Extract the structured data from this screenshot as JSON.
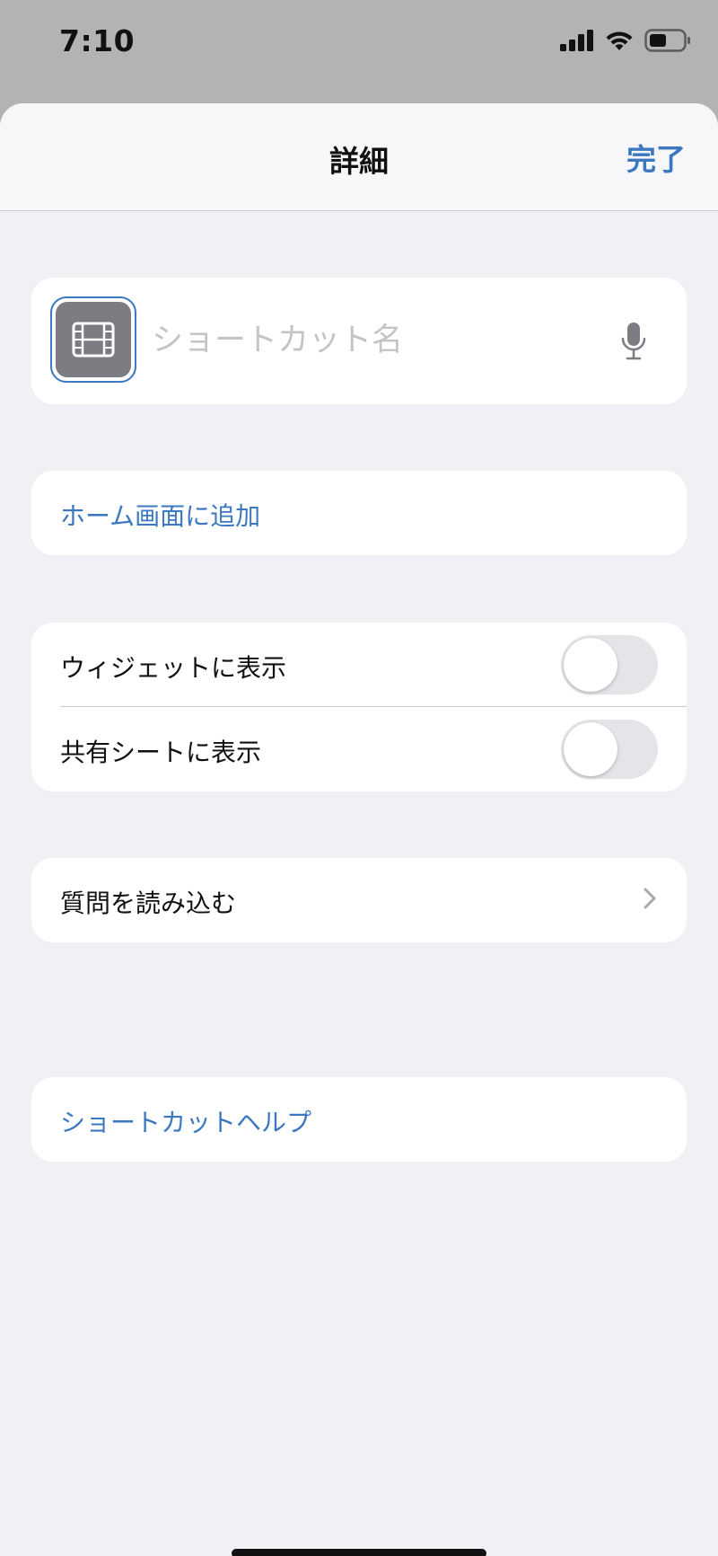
{
  "status_bar": {
    "time": "7:10",
    "icons": [
      "cellular-signal-icon",
      "wifi-icon",
      "battery-icon"
    ]
  },
  "navbar": {
    "title": "詳細",
    "done_label": "完了"
  },
  "shortcut": {
    "icon": "film-icon",
    "icon_color": "#7b7d82",
    "name_value": "",
    "name_placeholder": "ショートカット名"
  },
  "home_screen": {
    "label": "ホーム画面に追加"
  },
  "toggles": [
    {
      "label": "ウィジェットに表示",
      "on": false
    },
    {
      "label": "共有シートに表示",
      "on": false
    }
  ],
  "import_questions": {
    "label": "質問を読み込む"
  },
  "help": {
    "label": "ショートカットヘルプ"
  },
  "colors": {
    "accent": "#3b78c0",
    "background": "#f0f0f5",
    "card": "#ffffff"
  }
}
